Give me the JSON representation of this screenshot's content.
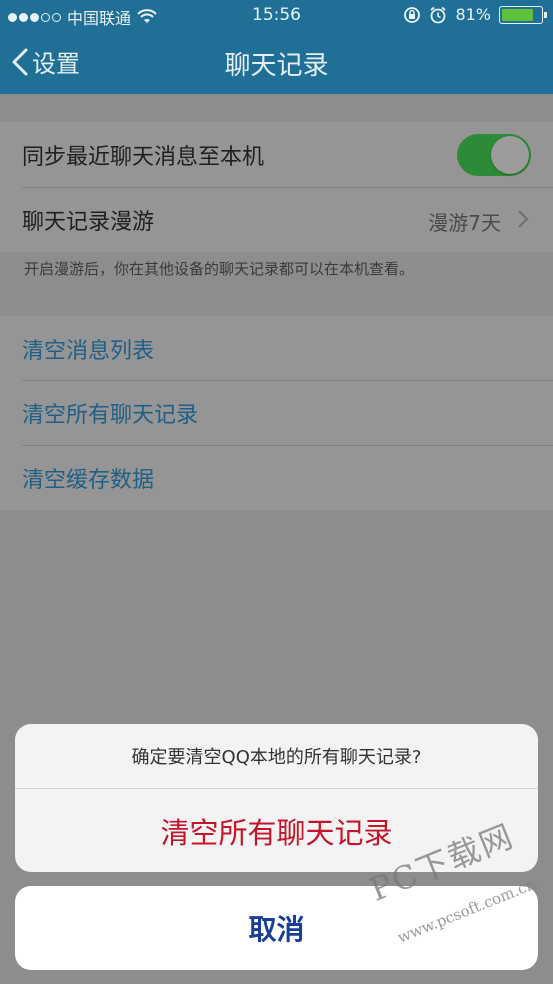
{
  "status_bar": {
    "carrier": "中国联通",
    "time": "15:56",
    "battery_percent": "81%",
    "battery_level": 0.81,
    "signal_filled": 3,
    "signal_total": 5
  },
  "nav": {
    "back_label": "设置",
    "title": "聊天记录"
  },
  "settings": {
    "sync_label": "同步最近聊天消息至本机",
    "sync_enabled": true,
    "roaming_label": "聊天记录漫游",
    "roaming_value": "漫游7天",
    "roaming_hint": "开启漫游后，你在其他设备的聊天记录都可以在本机查看。",
    "clear_list": "清空消息列表",
    "clear_all_history": "清空所有聊天记录",
    "clear_cache": "清空缓存数据"
  },
  "action_sheet": {
    "title": "确定要清空QQ本地的所有聊天记录?",
    "destructive_action": "清空所有聊天记录",
    "cancel": "取消"
  },
  "watermark": {
    "brand": "PC下载网",
    "url": "www.pcsoft.com.cn"
  },
  "colors": {
    "nav_bg": "#1f6f96",
    "toggle_on": "#2d8a36",
    "link": "#1f5f86",
    "destructive": "#c4162a",
    "cancel": "#1a3e96"
  }
}
